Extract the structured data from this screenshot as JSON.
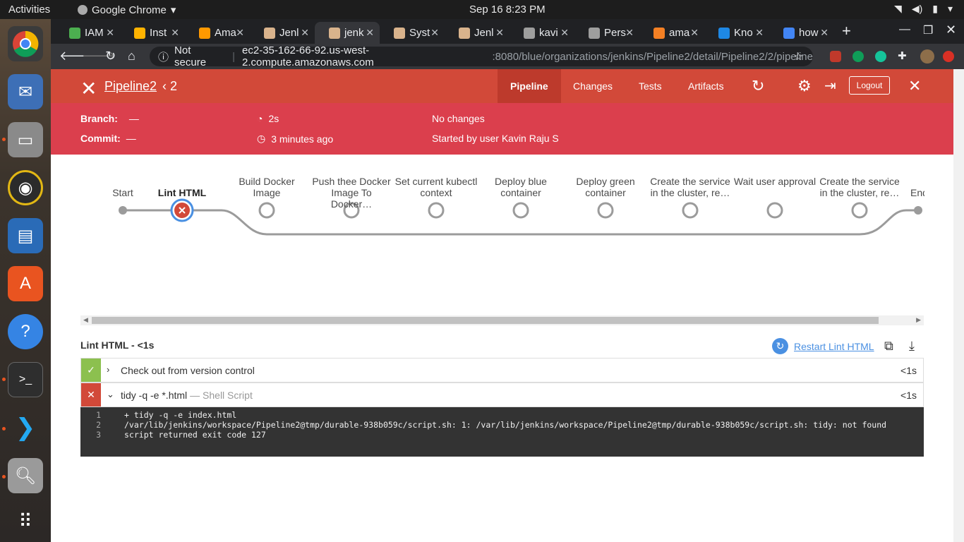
{
  "system": {
    "activities": "Activities",
    "app_name": "Google Chrome",
    "clock": "Sep 16  8:23 PM"
  },
  "tabs": [
    {
      "label": "IAM",
      "color": "#4caf50"
    },
    {
      "label": "Inst",
      "color": "#ffb300"
    },
    {
      "label": "Ama",
      "color": "#ff9900"
    },
    {
      "label": "Jenl",
      "color": "#d9b38c"
    },
    {
      "label": "jenk",
      "color": "#d9b38c"
    },
    {
      "label": "Syst",
      "color": "#d9b38c"
    },
    {
      "label": "Jenl",
      "color": "#d9b38c"
    },
    {
      "label": "kavi",
      "color": "#9e9e9e"
    },
    {
      "label": "Pers",
      "color": "#9e9e9e"
    },
    {
      "label": "ama",
      "color": "#f48024"
    },
    {
      "label": "Kno",
      "color": "#1e88e5"
    },
    {
      "label": "how",
      "color": "#4285f4"
    }
  ],
  "omnibox": {
    "security": "Not secure",
    "host": "ec2-35-162-66-92.us-west-2.compute.amazonaws.com",
    "path": ":8080/blue/organizations/jenkins/Pipeline2/detail/Pipeline2/2/pipeline"
  },
  "header": {
    "title": "Pipeline2",
    "run": "2",
    "tabs": [
      "Pipeline",
      "Changes",
      "Tests",
      "Artifacts"
    ],
    "logout": "Logout",
    "branch_label": "Branch:",
    "branch_value": "—",
    "commit_label": "Commit:",
    "commit_value": "—",
    "duration": "2s",
    "time_ago": "3 minutes ago",
    "changes": "No changes",
    "started_by": "Started by user Kavin Raju S",
    "accent": "#d24939"
  },
  "stages": [
    {
      "label": "Start",
      "status": "start"
    },
    {
      "label": "Lint HTML",
      "status": "failed"
    },
    {
      "label": "Build Docker Image",
      "status": "not_built"
    },
    {
      "label": "Push thee Docker Image To Docker…",
      "status": "not_built"
    },
    {
      "label": "Set current kubectl context",
      "status": "not_built"
    },
    {
      "label": "Deploy blue container",
      "status": "not_built"
    },
    {
      "label": "Deploy green container",
      "status": "not_built"
    },
    {
      "label": "Create the service in the cluster, re…",
      "status": "not_built"
    },
    {
      "label": "Wait user approval",
      "status": "not_built"
    },
    {
      "label": "Create the service in the cluster, re…",
      "status": "not_built"
    },
    {
      "label": "End",
      "status": "end"
    }
  ],
  "steps": {
    "title": "Lint HTML - <1s",
    "restart": "Restart Lint HTML",
    "items": [
      {
        "name": "Check out from version control",
        "desc": "",
        "duration": "<1s",
        "status": "success",
        "color": "#8cc04f"
      },
      {
        "name": "tidy -q -e *.html",
        "desc": "— Shell Script",
        "duration": "<1s",
        "status": "failed",
        "color": "#d24939"
      }
    ],
    "log": [
      {
        "n": "1",
        "text": "+ tidy -q -e index.html"
      },
      {
        "n": "2",
        "text": "/var/lib/jenkins/workspace/Pipeline2@tmp/durable-938b059c/script.sh: 1: /var/lib/jenkins/workspace/Pipeline2@tmp/durable-938b059c/script.sh: tidy: not found"
      },
      {
        "n": "3",
        "text": "script returned exit code 127"
      }
    ]
  }
}
